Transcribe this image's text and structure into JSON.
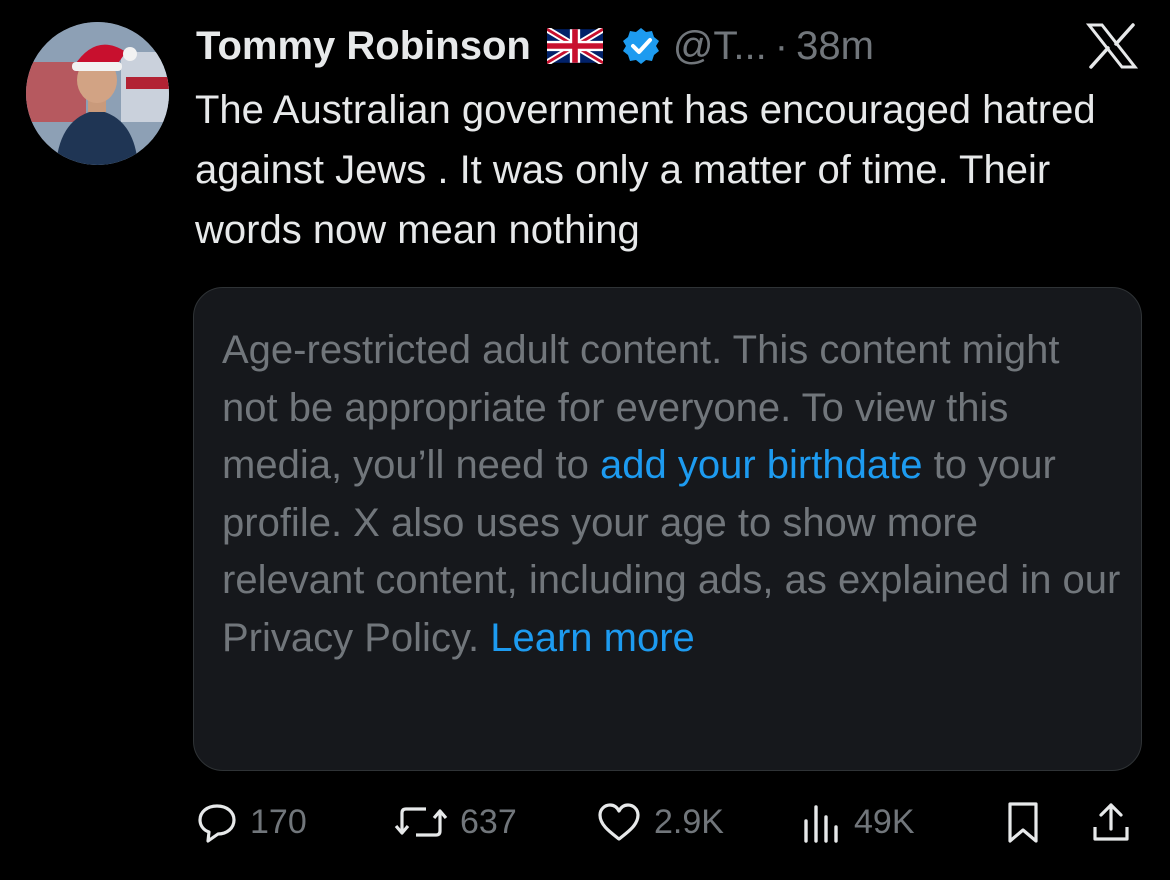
{
  "post": {
    "author_name": "Tommy Robinson",
    "handle": "@T...",
    "separator": "·",
    "time": "38m",
    "text": "The Australian government has encouraged hatred against Jews . It was only a matter of time. Their words now mean nothing"
  },
  "icons": {
    "flag": "uk-flag-icon",
    "verified": "verified-badge-icon",
    "logo": "x-logo-icon"
  },
  "media_notice": {
    "text_before_link": "Age-restricted adult content. This content might not be appropriate for everyone. To view this media, you’ll need to ",
    "link_birthdate": "add your birthdate",
    "text_after_link": " to your profile. X also uses your age to show more relevant content, including ads, as explained in our Privacy Policy. ",
    "link_learn_more": "Learn more"
  },
  "actions": {
    "replies": "170",
    "reposts": "637",
    "likes": "2.9K",
    "views": "49K"
  },
  "colors": {
    "background": "#000000",
    "text_primary": "#e7e9ea",
    "text_secondary": "#71767b",
    "link": "#1d9bf0",
    "verified": "#1d9bf0",
    "card_background": "#16181c"
  }
}
